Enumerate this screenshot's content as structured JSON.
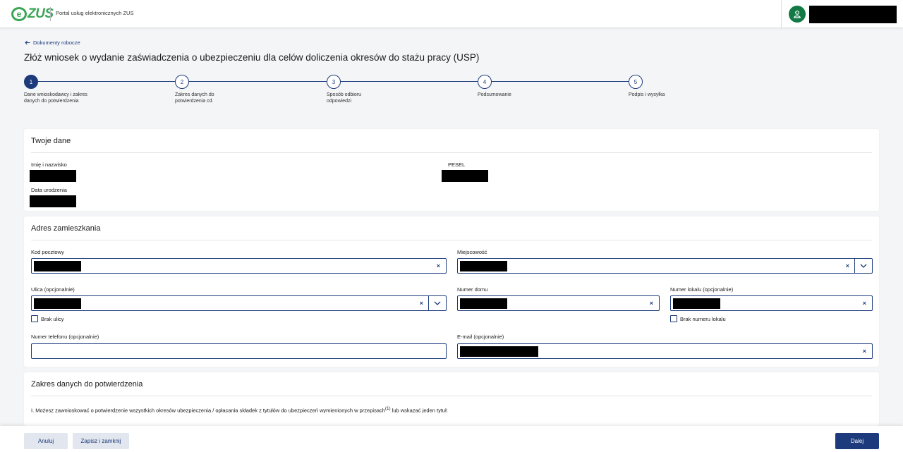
{
  "header": {
    "logo_e": "e",
    "logo_text": "ZUS",
    "portal_name": "Portal usług elektronicznych ZUS",
    "user_icon": "user-icon"
  },
  "nav": {
    "back_label": "Dokumenty robocze"
  },
  "page": {
    "title": "Złóż wniosek o wydanie zaświadczenia o ubezpieczeniu dla celów doliczenia okresów do stażu pracy (USP)"
  },
  "stepper": {
    "active_step": 1,
    "steps": [
      {
        "number": "1",
        "label": "Dane wnioskodawcy i zakres danych do potwierdzenia"
      },
      {
        "number": "2",
        "label": "Zakres danych do potwierdzenia cd."
      },
      {
        "number": "3",
        "label": "Sposób odbioru odpowiedzi"
      },
      {
        "number": "4",
        "label": "Podsumowanie"
      },
      {
        "number": "5",
        "label": "Podpis i wysyłka"
      }
    ]
  },
  "personal": {
    "title": "Twoje dane",
    "name_label": "Imię i nazwisko",
    "pesel_label": "PESEL",
    "birth_label": "Data urodzenia"
  },
  "address": {
    "title": "Adres zamieszkania",
    "postal_code_label": "Kod pocztowy",
    "city_label": "Miejscowość",
    "street_label": "Ulica (opcjonalnie)",
    "house_number_label": "Numer domu",
    "apartment_label": "Numer lokalu (opcjonalnie)",
    "no_street_label": "Brak ulicy",
    "no_apartment_label": "Brak numeru lokalu",
    "phone_label": "Numer telefonu (opcjonalnie)",
    "email_label": "E-mail (opcjonalnie)",
    "phone_value": "",
    "clear_glyph": "×"
  },
  "scope": {
    "title": "Zakres danych do potwierdzenia",
    "text_main": "I. Możesz zawnioskować o potwierdzenie wszystkich okresów ubezpieczenia / opłacania składek z tytułów do ubezpieczeń wymienionych w przepisach",
    "footnote": "(1)",
    "text_tail": " lub wskazać jeden tytuł:"
  },
  "footer": {
    "cancel_label": "Anuluj",
    "save_close_label": "Zapisz i zamknij",
    "next_label": "Dalej"
  }
}
